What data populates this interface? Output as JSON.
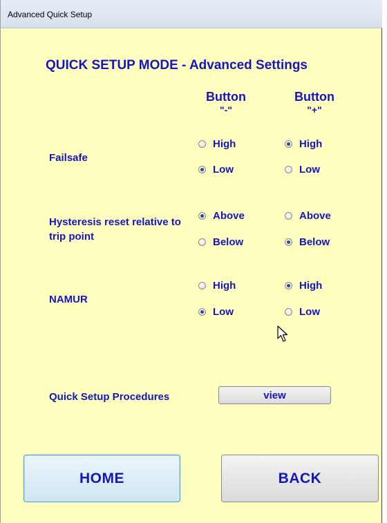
{
  "window": {
    "title": "Advanced Quick Setup"
  },
  "heading": "QUICK SETUP MODE - Advanced Settings",
  "columns": [
    {
      "line1": "Button",
      "line2": "\"-\""
    },
    {
      "line1": "Button",
      "line2": "\"+\""
    }
  ],
  "rows": [
    {
      "label": "Failsafe",
      "options": [
        "High",
        "Low"
      ],
      "minus_selected": "Low",
      "plus_selected": "High"
    },
    {
      "label": "Hysteresis reset relative to trip point",
      "options": [
        "Above",
        "Below"
      ],
      "minus_selected": "Above",
      "plus_selected": "Below"
    },
    {
      "label": "NAMUR",
      "options": [
        "High",
        "Low"
      ],
      "minus_selected": "Low",
      "plus_selected": "High"
    }
  ],
  "procedures": {
    "label": "Quick Setup Procedures",
    "button": "view"
  },
  "buttons": {
    "home": "HOME",
    "back": "BACK"
  },
  "colors": {
    "background": "#ffffc0",
    "text": "#1515c0",
    "home_border": "#3fa0d8"
  }
}
